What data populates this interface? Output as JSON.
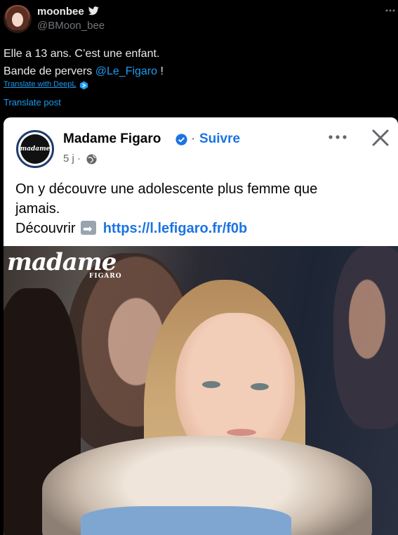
{
  "tweet": {
    "display_name": "moonbee",
    "handle": "@BMoon_bee",
    "text_line1": "Elle a 13 ans. C’est une enfant.",
    "text_line2_prefix": "Bande de pervers ",
    "mention": "@Le_Figaro",
    "text_line2_suffix": " !",
    "deepl_label": "Translate with DeepL",
    "translate_post": "Translate post"
  },
  "embedded_post": {
    "page_name": "Madame Figaro",
    "separator": " · ",
    "follow_label": "Suivre",
    "time": "5 j ·",
    "logo_text": "madame",
    "text_line1": "On y découvre une adolescente plus femme que",
    "text_line2": "jamais.",
    "cta_label": "Découvrir",
    "link": "https://l.lefigaro.fr/f0b",
    "watermark": "madame",
    "watermark_sub": "FIGARO"
  },
  "icons": {
    "verified": "bird-verified-icon",
    "more": "more-dots-icon",
    "deepl": "deepl-icon",
    "page_verified": "verified-badge-icon",
    "globe": "globe-icon",
    "close": "close-icon"
  },
  "colors": {
    "link_blue": "#1d9bf0",
    "facebook_blue": "#1b74e4",
    "background": "#000000"
  }
}
